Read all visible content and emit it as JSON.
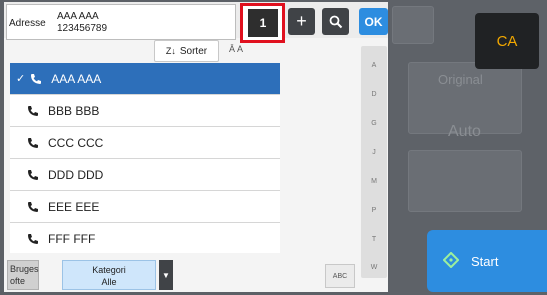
{
  "address": {
    "label": "Adresse",
    "line1": "AAA AAA",
    "line2": "123456789"
  },
  "count": "1",
  "toolbar": {
    "add": "+",
    "search": "search",
    "ok": "OK"
  },
  "sort": {
    "label": "Sorter"
  },
  "contacts": [
    {
      "name": "AAA AAA",
      "selected": true
    },
    {
      "name": "BBB BBB",
      "selected": false
    },
    {
      "name": "CCC CCC",
      "selected": false
    },
    {
      "name": "DDD DDD",
      "selected": false
    },
    {
      "name": "EEE EEE",
      "selected": false
    },
    {
      "name": "FFF FFF",
      "selected": false
    }
  ],
  "index_letters": [
    "A",
    "D",
    "G",
    "J",
    "M",
    "P",
    "T",
    "W"
  ],
  "abc_button": "ABC",
  "bottom": {
    "tab1_line1": "Bruges",
    "tab1_line2": "ofte",
    "tab2_line1": "Kategori",
    "tab2_line2": "Alle"
  },
  "right": {
    "ca": "CA",
    "start": "Start",
    "bg_original": "Original",
    "bg_auto": "Auto"
  },
  "colors": {
    "accent_blue": "#2d8de0",
    "selected_row": "#2d6fba",
    "highlight_red": "#e0101e",
    "ca_orange": "#f2a800"
  }
}
